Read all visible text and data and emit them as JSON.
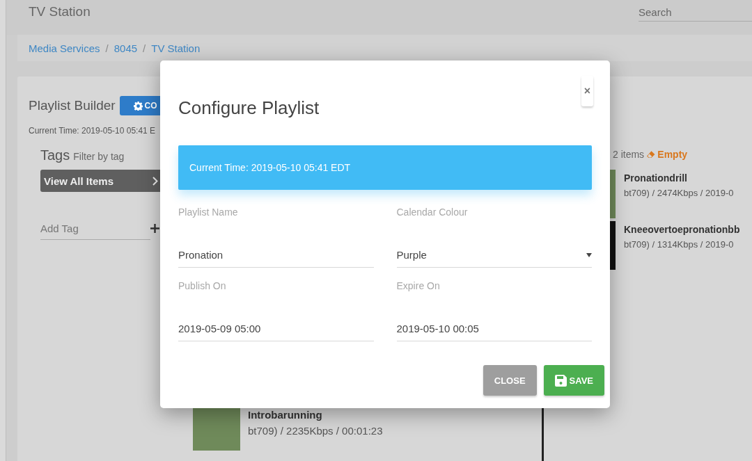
{
  "app": {
    "title": "TV Station",
    "search": {
      "placeholder": "Search"
    }
  },
  "breadcrumbs": [
    {
      "label": "Media Services",
      "separator": "/"
    },
    {
      "label": "8045",
      "separator": "/"
    },
    {
      "label": "TV Station"
    }
  ],
  "playlist_builder": {
    "title": "Playlist Builder",
    "config_button": "CO",
    "current_time": "Current Time: 2019-05-10 05:41 E"
  },
  "tags": {
    "title": "Tags",
    "subtitle": "Filter by tag",
    "view_all": "View All Items",
    "add_tag": {
      "placeholder": "Add Tag"
    }
  },
  "library": {
    "items": [
      {
        "title": "Introbarunning",
        "details": "bt709) / 2235Kbps / 00:01:23"
      }
    ]
  },
  "playlist": {
    "count": "2 items",
    "empty_button": "Empty",
    "items": [
      {
        "title": "Pronationdrill",
        "details": "bt709) / 2474Kbps / 2019-0"
      },
      {
        "title": "Kneeovertoepronationbb",
        "details": "bt709) / 1314Kbps / 2019-0"
      }
    ]
  },
  "dialog": {
    "close": "×",
    "title": "Configure Playlist",
    "alert": "Current Time: 2019-05-10 05:41 EDT",
    "fields": [
      {
        "kind": "text",
        "label": "Playlist Name",
        "value": "Pronation"
      },
      {
        "kind": "select",
        "label": "Calendar Colour",
        "value": "Purple"
      },
      {
        "kind": "text",
        "label": "Publish On",
        "value": "2019-05-09 05:00"
      },
      {
        "kind": "text",
        "label": "Expire On",
        "value": "2019-05-10 00:05"
      }
    ],
    "buttons": [
      {
        "kind": "close",
        "label": "CLOSE"
      },
      {
        "kind": "save",
        "label": "SAVE"
      }
    ]
  }
}
